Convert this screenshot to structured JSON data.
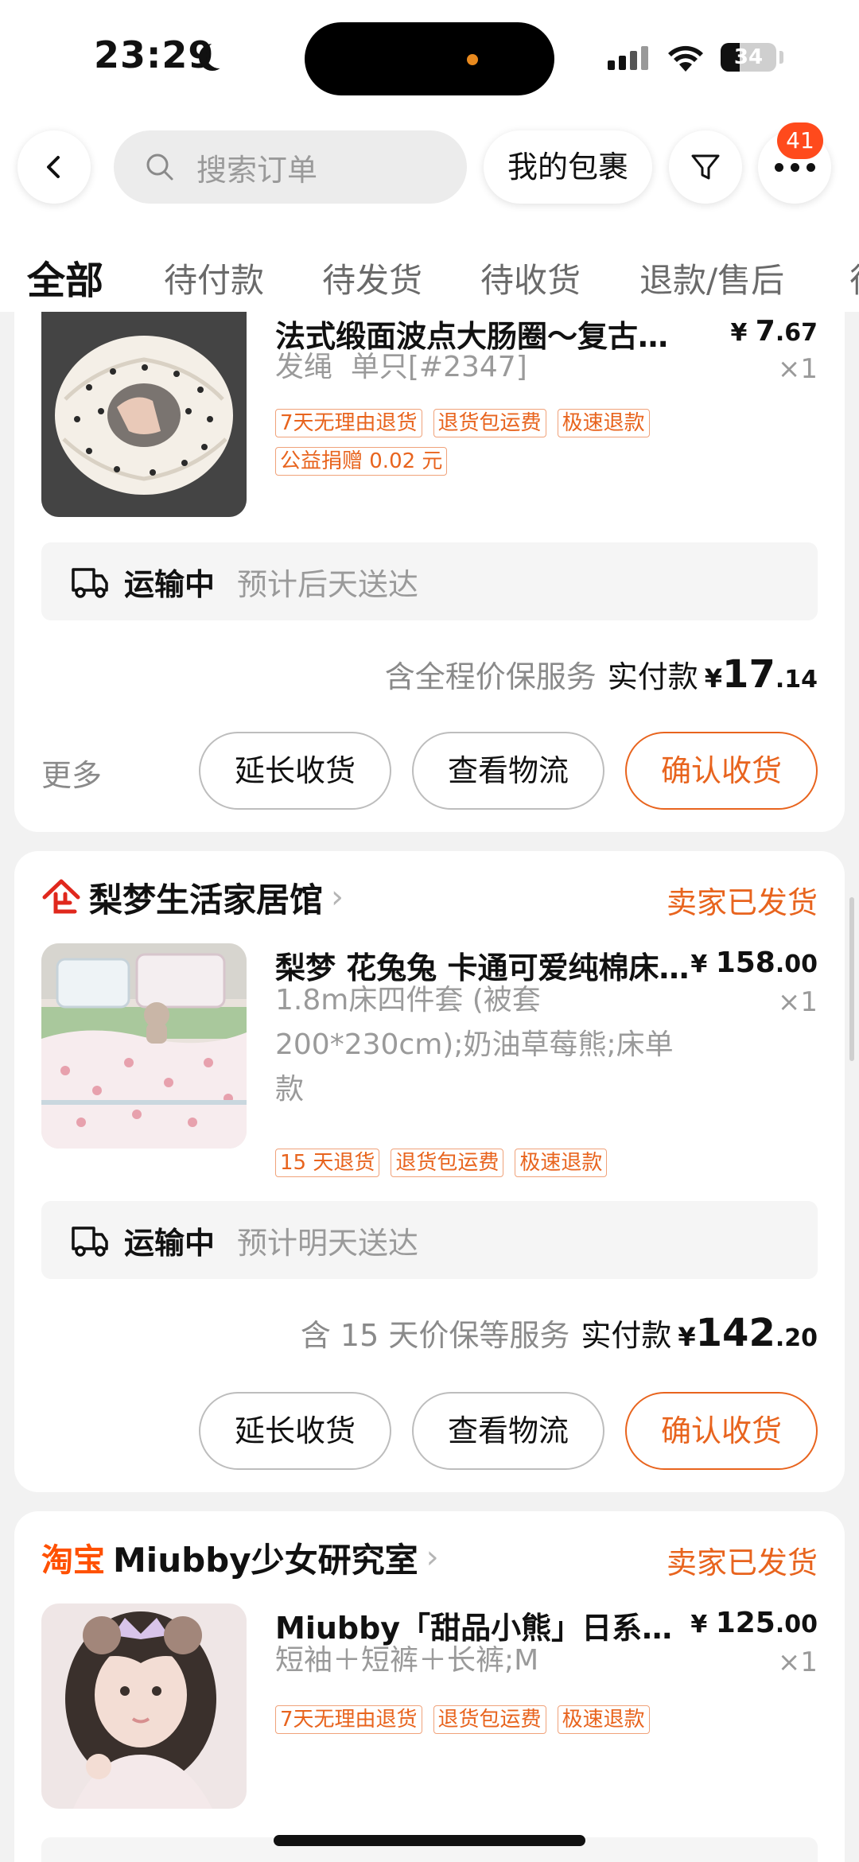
{
  "status_bar": {
    "time": "23:29",
    "battery": "34",
    "battery_level": 0.34
  },
  "header": {
    "search_placeholder": "搜索订单",
    "packages_label": "我的包裹",
    "notification_count": "41"
  },
  "tabs": [
    {
      "label": "全部",
      "active": true
    },
    {
      "label": "待付款",
      "active": false
    },
    {
      "label": "待发货",
      "active": false
    },
    {
      "label": "待收货",
      "active": false
    },
    {
      "label": "退款/售后",
      "active": false
    },
    {
      "label": "待",
      "active": false
    }
  ],
  "orders": [
    {
      "product": {
        "title": "法式缎面波点大肠圈～复古温柔发圈",
        "price_symbol": "¥",
        "price_int": "7",
        "price_dec": ".67",
        "spec": "发绳  单只[#2347]",
        "qty": "×1",
        "tags": [
          "7天无理由退货",
          "退货包运费",
          "极速退款",
          "公益捐赠 0.02 元"
        ]
      },
      "shipping": {
        "status": "运输中",
        "eta": "预计后天送达"
      },
      "payment": {
        "service": "含全程价保服务",
        "label": "实付款",
        "symbol": "¥",
        "int": "17",
        "dec": ".14"
      },
      "more_label": "更多",
      "actions": {
        "extend": "延长收货",
        "logistics": "查看物流",
        "confirm": "确认收货"
      }
    },
    {
      "shop": {
        "badge": "企",
        "name": "梨梦生活家居馆",
        "status": "卖家已发货"
      },
      "product": {
        "title": "梨梦 花兔兔 卡通可爱纯棉床上四件套",
        "price_symbol": "¥",
        "price_int": "158",
        "price_dec": ".00",
        "spec": "1.8m床四件套 (被套200*230cm);奶油草莓熊;床单款",
        "qty": "×1",
        "tags": [
          "15 天退货",
          "退货包运费",
          "极速退款"
        ]
      },
      "shipping": {
        "status": "运输中",
        "eta": "预计明天送达"
      },
      "payment": {
        "service": "含 15 天价保等服务",
        "label": "实付款",
        "symbol": "¥",
        "int": "142",
        "dec": ".20"
      },
      "actions": {
        "extend": "延长收货",
        "logistics": "查看物流",
        "confirm": "确认收货"
      }
    },
    {
      "shop": {
        "badge": "淘宝",
        "name": "Miubby少女研究室",
        "status": "卖家已发货"
      },
      "product": {
        "title": "Miubby「甜品小熊」日系卡通睡衣套装",
        "price_symbol": "¥",
        "price_int": "125",
        "price_dec": ".00",
        "spec": "短袖＋短裤＋长裤;M",
        "qty": "×1",
        "tags": [
          "7天无理由退货",
          "退货包运费",
          "极速退款"
        ]
      }
    }
  ],
  "colors": {
    "accent": "#e8641e",
    "badge": "#ff4a1c",
    "tmall_red": "#e0281d",
    "taobao_orange": "#ff5000"
  }
}
